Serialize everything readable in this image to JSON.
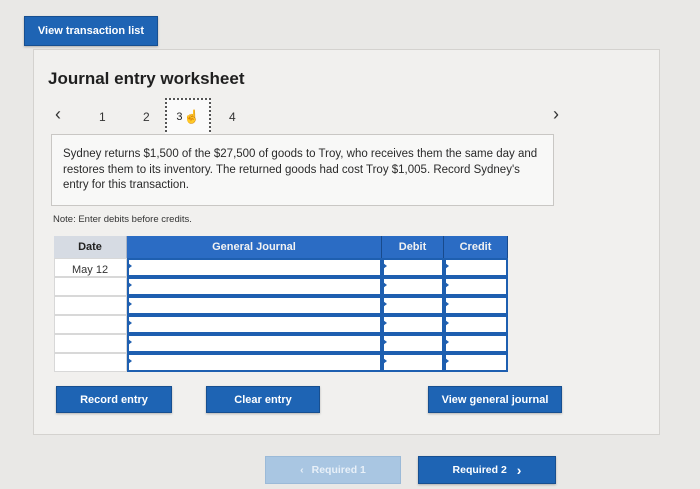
{
  "top": {
    "view_transaction_list": "View transaction list"
  },
  "worksheet": {
    "title": "Journal entry worksheet",
    "steps": [
      "1",
      "2",
      "3",
      "4"
    ],
    "prompt": "Sydney returns $1,500 of the $27,500 of goods to Troy, who receives them the same day and restores them to its inventory. The returned goods had cost Troy $1,005. Record Sydney's entry for this transaction.",
    "note": "Note: Enter debits before credits.",
    "table": {
      "headers": {
        "date": "Date",
        "journal": "General Journal",
        "debit": "Debit",
        "credit": "Credit"
      },
      "rows": [
        {
          "date": "May 12",
          "journal": "",
          "debit": "",
          "credit": ""
        },
        {
          "date": "",
          "journal": "",
          "debit": "",
          "credit": ""
        },
        {
          "date": "",
          "journal": "",
          "debit": "",
          "credit": ""
        },
        {
          "date": "",
          "journal": "",
          "debit": "",
          "credit": ""
        },
        {
          "date": "",
          "journal": "",
          "debit": "",
          "credit": ""
        },
        {
          "date": "",
          "journal": "",
          "debit": "",
          "credit": ""
        }
      ]
    },
    "buttons": {
      "record": "Record entry",
      "clear": "Clear entry",
      "view_general_journal": "View general journal"
    }
  },
  "footer": {
    "prev": "Required 1",
    "next": "Required 2"
  },
  "icons": {
    "prev": "chevron-left-icon",
    "next": "chevron-right-icon",
    "cursor": "hand-cursor-icon"
  },
  "colors": {
    "primary": "#1e64b4",
    "table_header": "#2b6cc4",
    "disabled": "#a9c6e2"
  }
}
